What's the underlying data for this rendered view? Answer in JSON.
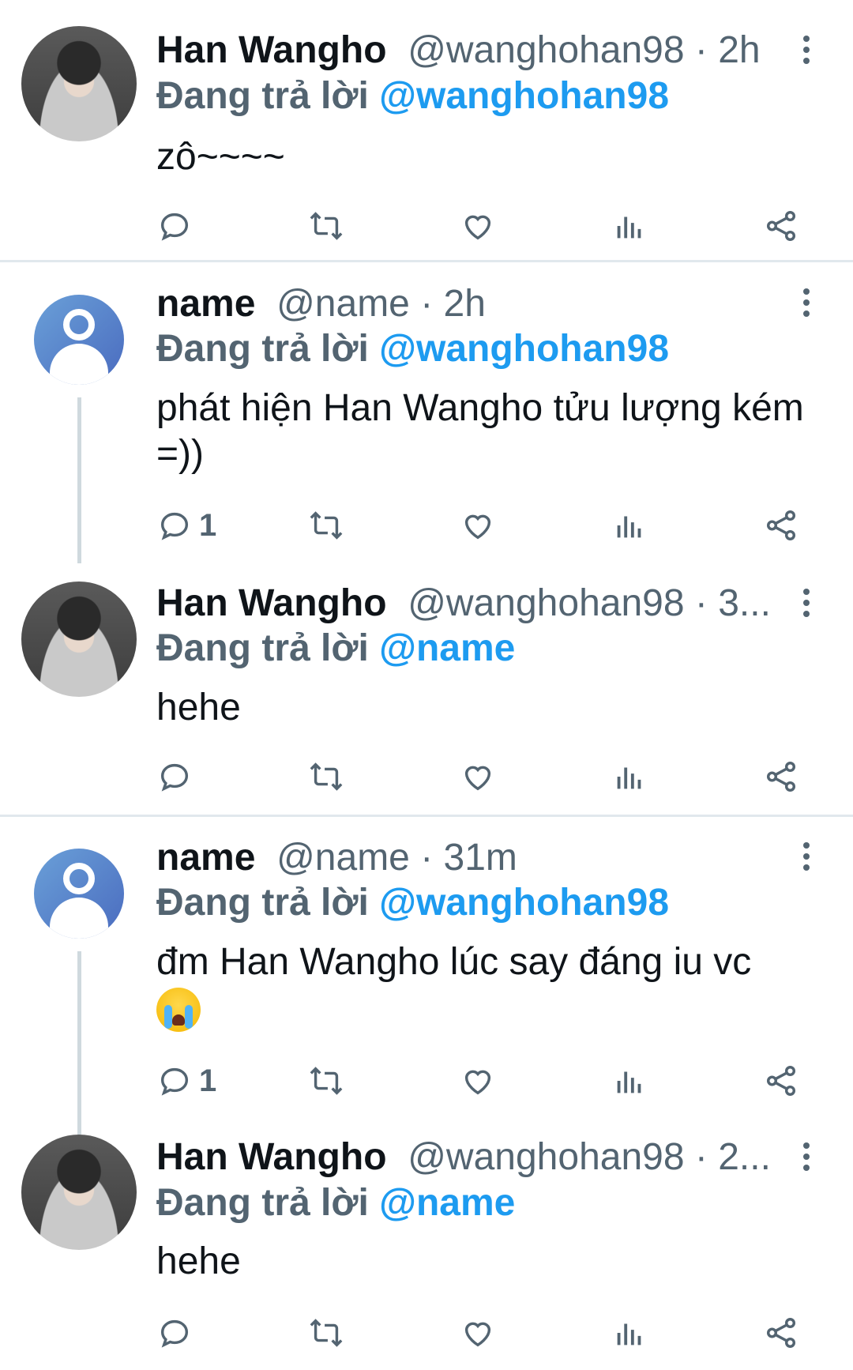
{
  "tweets": [
    {
      "author": "Han Wangho",
      "handle": "@wanghohan98",
      "time_sep": " · ",
      "time": "2h",
      "reply_prefix": "Đang trả lời ",
      "reply_to": "@wanghohan98",
      "text": "zô~~~~",
      "reply_count": "",
      "avatar": "profile-photo"
    },
    {
      "author": "name",
      "handle": "@name",
      "time_sep": " · ",
      "time": "2h",
      "reply_prefix": "Đang trả lời ",
      "reply_to": "@wanghohan98",
      "text": "phát hiện Han Wangho tửu lượng kém =))",
      "reply_count": "1",
      "avatar": "default-avatar"
    },
    {
      "author": "Han Wangho",
      "handle": "@wanghohan98",
      "time_sep": " · ",
      "time": "3...",
      "reply_prefix": "Đang trả lời ",
      "reply_to": "@name",
      "text": "hehe",
      "reply_count": "",
      "avatar": "profile-photo"
    },
    {
      "author": "name",
      "handle": "@name",
      "time_sep": " · ",
      "time": "31m",
      "reply_prefix": "Đang trả lời ",
      "reply_to": "@wanghohan98",
      "text": "đm Han Wangho lúc say đáng iu vc",
      "emoji": "loudly-crying-face-emoji",
      "reply_count": "1",
      "avatar": "default-avatar"
    },
    {
      "author": "Han Wangho",
      "handle": "@wanghohan98",
      "time_sep": " · ",
      "time": "2...",
      "reply_prefix": "Đang trả lời ",
      "reply_to": "@name",
      "text": "hehe",
      "reply_count": "",
      "avatar": "profile-photo"
    }
  ],
  "icons": [
    "reply-icon",
    "retweet-icon",
    "like-icon",
    "analytics-icon",
    "share-icon",
    "more-options-icon"
  ],
  "colors": {
    "link": "#1d9bf0",
    "secondary": "#536471",
    "text": "#0f1419",
    "thread_line": "#cfd9de"
  }
}
